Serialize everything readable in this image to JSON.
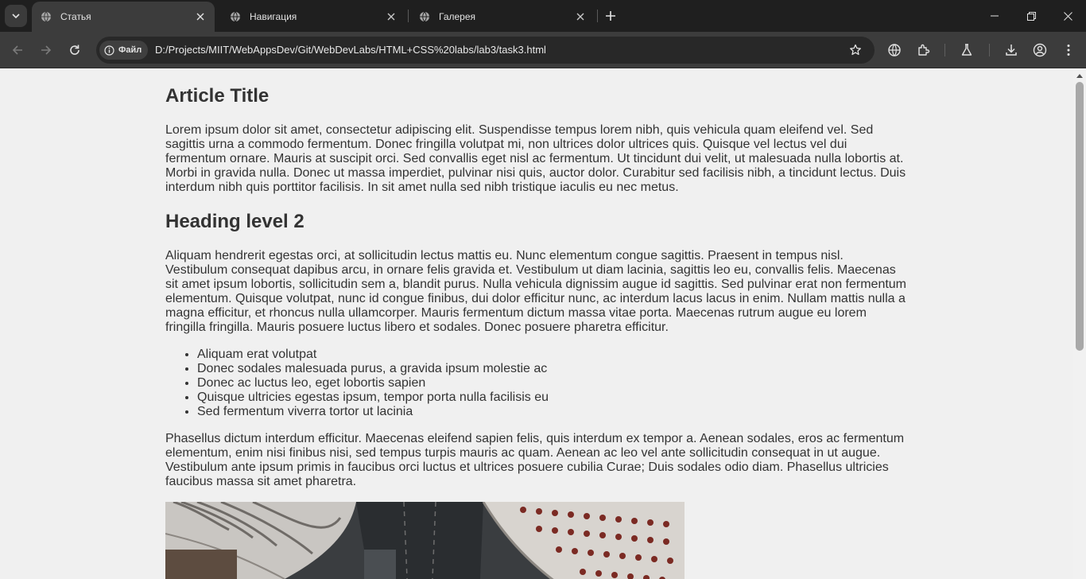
{
  "browser": {
    "tabs": [
      {
        "label": "Статья",
        "active": true
      },
      {
        "label": "Навигация",
        "active": false
      },
      {
        "label": "Галерея",
        "active": false
      }
    ],
    "site_chip": "Файл",
    "url": "D:/Projects/MIIT/WebAppsDev/Git/WebDevLabs/HTML+CSS%20labs/lab3/task3.html",
    "icons": [
      "tab-search-icon",
      "globe-icon",
      "close-icon",
      "plus-icon",
      "minimize-icon",
      "restore-icon",
      "back-icon",
      "forward-icon",
      "reload-icon",
      "info-icon",
      "star-icon",
      "translate-icon",
      "extensions-icon",
      "labs-icon",
      "download-icon",
      "profile-icon",
      "menu-icon"
    ],
    "colors": {
      "tabstrip": "#1f1f1f",
      "toolbar": "#3c3c3c",
      "omnibox": "#282828",
      "page_bg": "#f0f0f0",
      "text": "#333333"
    }
  },
  "article": {
    "title": "Article Title",
    "intro": "Lorem ipsum dolor sit amet, consectetur adipiscing elit. Suspendisse tempus lorem nibh, quis vehicula quam eleifend vel. Sed sagittis urna a commodo fermentum. Donec fringilla volutpat mi, non ultrices dolor ultrices quis. Quisque vel lectus vel dui fermentum ornare. Mauris at suscipit orci. Sed convallis eget nisl ac fermentum. Ut tincidunt dui velit, ut malesuada nulla lobortis at. Morbi in gravida nulla. Donec ut massa imperdiet, pulvinar nisi quis, auctor dolor. Curabitur sed facilisis nibh, a tincidunt lectus. Duis interdum nibh quis porttitor facilisis. In sit amet nulla sed nibh tristique iaculis eu nec metus.",
    "heading2": "Heading level 2",
    "paragraph2": "Aliquam hendrerit egestas orci, at sollicitudin lectus mattis eu. Nunc elementum congue sagittis. Praesent in tempus nisl. Vestibulum consequat dapibus arcu, in ornare felis gravida et. Vestibulum ut diam lacinia, sagittis leo eu, convallis felis. Maecenas sit amet ipsum lobortis, sollicitudin sem a, blandit purus. Nulla vehicula dignissim augue id sagittis. Sed pulvinar erat non fermentum elementum. Quisque volutpat, nunc id congue finibus, dui dolor efficitur nunc, ac interdum lacus lacus in enim. Nullam mattis nulla a magna efficitur, et rhoncus nulla ullamcorper. Mauris fermentum dictum massa vitae porta. Maecenas rutrum augue eu lorem fringilla fringilla. Mauris posuere luctus libero et sodales. Donec posuere pharetra efficitur.",
    "list": [
      "Aliquam erat volutpat",
      "Donec sodales malesuada purus, a gravida ipsum molestie ac",
      "Donec ac luctus leo, eget lobortis sapien",
      "Quisque ultricies egestas ipsum, tempor porta nulla facilisis eu",
      "Sed fermentum viverra tortor ut lacinia"
    ],
    "paragraph3": "Phasellus dictum interdum efficitur. Maecenas eleifend sapien felis, quis interdum ex tempor a. Aenean sodales, eros ac fermentum elementum, enim nisi finibus nisi, sed tempus turpis mauris ac quam. Aenean ac leo vel ante sollicitudin consequat in ut augue. Vestibulum ante ipsum primis in faucibus orci luctus et ultrices posuere cubilia Curae; Duis sodales odio diam. Phasellus ultricies faucibus massa sit amet pharetra."
  }
}
